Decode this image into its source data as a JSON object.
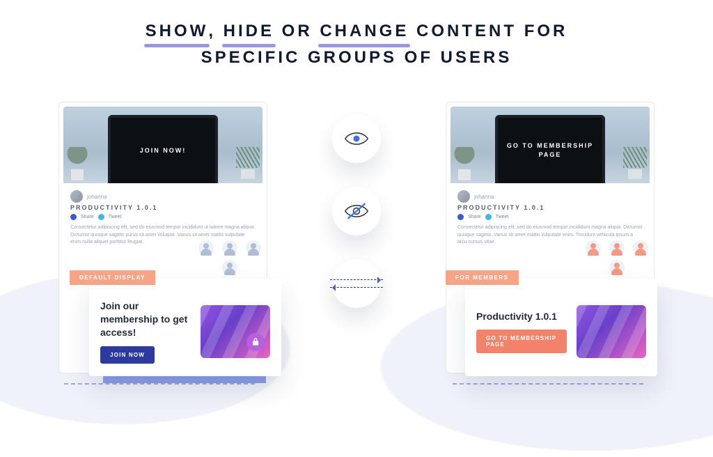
{
  "headline": {
    "w1": "SHOW",
    "w2": "HIDE",
    "w3": "CHANGE",
    "mid": " OR ",
    "sep": ", ",
    "tail1": " CONTENT FOR",
    "line2": "SPECIFIC GROUPS OF USERS"
  },
  "post": {
    "author": "johanna",
    "title": "PRODUCTIVITY 1.0.1",
    "share_fb": "Share",
    "share_tw": "Tweet",
    "lorem_l": "Consectetur adipiscing elit, sed do eiusmod tempor incididunt ut labore magna aliqua. Dictumst quisque sagittis purus sit amet volutpat. Varius sit amet mattis vulputate enim nulla aliquet porttitor feugiat.",
    "lorem_r": "Consectetur adipiscing elit, sed do eiusmod tempor incididunt magna aliqua. Dictumst quisque sagittis. Varius sit amet mattis vulputate enim. Tincidunt vehicula ipsum a arcu cursus vitae."
  },
  "hero": {
    "left_screen": "JOIN NOW!",
    "right_screen": "GO TO MEMBERSHIP PAGE"
  },
  "callout_left": {
    "tag": "DEFAULT DISPLAY",
    "title": "Join our membership to get access!",
    "button": "JOIN NOW"
  },
  "callout_right": {
    "tag": "FOR MEMBERS",
    "title": "Productivity 1.0.1",
    "button": "GO TO MEMBERSHIP PAGE"
  },
  "icons": {
    "show": "eye-icon",
    "hide": "eye-off-icon",
    "swap": "swap-arrows-icon"
  }
}
